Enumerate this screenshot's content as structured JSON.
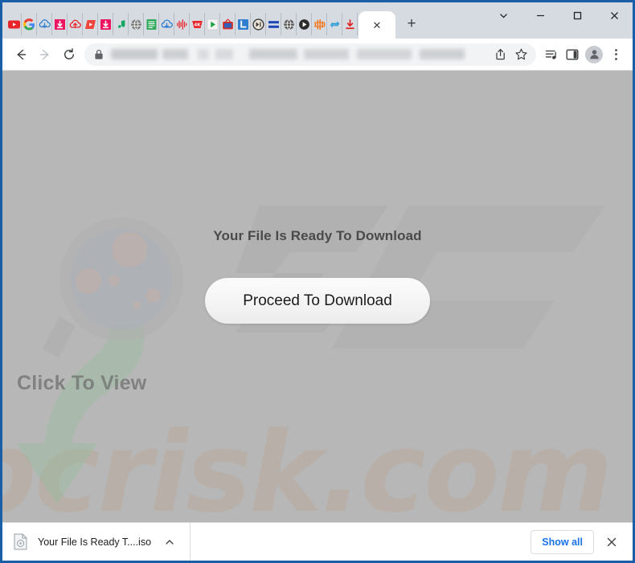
{
  "window": {
    "controls": [
      {
        "name": "tab-search",
        "glyph": "⌄"
      },
      {
        "name": "minimize",
        "glyph": "–"
      },
      {
        "name": "maximize",
        "glyph": "□"
      },
      {
        "name": "close",
        "glyph": "✕"
      }
    ]
  },
  "tabstrip": {
    "pinned_tabs": [
      {
        "icon": "youtube-icon",
        "color": "#e8262a"
      },
      {
        "icon": "google-g-icon",
        "color": "#4285f4"
      },
      {
        "icon": "cloud-download-blue-icon",
        "color": "#2f7fd1"
      },
      {
        "icon": "download-box-pink-icon",
        "color": "#ec1561"
      },
      {
        "icon": "cloud-upload-red-icon",
        "color": "#e8262a"
      },
      {
        "icon": "video-play-red-icon",
        "color": "#f0453d"
      },
      {
        "icon": "download-box-red-icon",
        "color": "#ec1561"
      },
      {
        "icon": "music-note-green-icon",
        "color": "#16a864"
      },
      {
        "icon": "globe-gray-icon",
        "color": "#7b7b7b"
      },
      {
        "icon": "list-document-green-icon",
        "color": "#2faa5a"
      },
      {
        "icon": "cloud-download-outline-icon",
        "color": "#2f7fd1"
      },
      {
        "icon": "waveform-red-icon",
        "color": "#e8262a"
      },
      {
        "icon": "4k-video-red-icon",
        "color": "#e8262a"
      },
      {
        "icon": "play-green-icon",
        "color": "#19a340"
      },
      {
        "icon": "tv-red-icon",
        "color": "#d62b24"
      },
      {
        "icon": "letter-l-blue-icon",
        "color": "#2f7fd1"
      },
      {
        "icon": "play-pause-circle-icon",
        "color": "#3a3a3a"
      },
      {
        "icon": "blue-bars-icon",
        "color": "#1c45b8"
      },
      {
        "icon": "globe-dark-icon",
        "color": "#5b5b5b"
      },
      {
        "icon": "play-circle-dark-icon",
        "color": "#2b2b2b"
      },
      {
        "icon": "orange-waveform-icon",
        "color": "#f27318"
      },
      {
        "icon": "convert-arrows-blue-icon",
        "color": "#2f9fd8"
      },
      {
        "icon": "download-underline-red-icon",
        "color": "#e02020"
      }
    ],
    "active_tab": {
      "close_glyph": "✕"
    },
    "new_tab_glyph": "+"
  },
  "toolbar": {
    "back_glyph": "←",
    "forward_glyph": "→",
    "reload_glyph": "⟳",
    "omnibox": {
      "url_text": "",
      "lock_name": "site-secure-lock"
    },
    "share_name": "share-icon",
    "bookmark_name": "bookmark-star-icon",
    "media_name": "media-playlist-icon",
    "side_panel_name": "side-panel-icon",
    "profile_name": "profile-avatar",
    "menu_name": "three-dot-menu"
  },
  "page": {
    "headline": "Your File Is Ready To Download",
    "proceed_button": "Proceed To Download",
    "click_to_view_label": "Click To View",
    "watermark_text": "pcrisk.com",
    "background_color": "#b7b7b7"
  },
  "download_shelf": {
    "filename": "Your File Is Ready T....iso",
    "chevron_glyph": "⌃",
    "show_all_label": "Show all",
    "close_glyph": "✕"
  }
}
